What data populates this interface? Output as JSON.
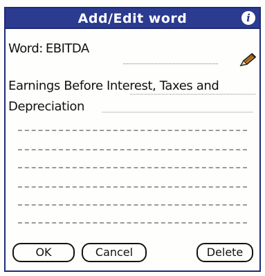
{
  "dialog": {
    "title": "Add/Edit word",
    "info_icon": "i"
  },
  "word": {
    "label": "Word:",
    "value": "EBITDA"
  },
  "definition": {
    "text": "Earnings Before Interest, Taxes and Depreciation"
  },
  "buttons": {
    "ok": "OK",
    "cancel": "Cancel",
    "delete": "Delete"
  },
  "colors": {
    "titlebar": "#2b3b8f",
    "frame": "#1e2a78"
  }
}
